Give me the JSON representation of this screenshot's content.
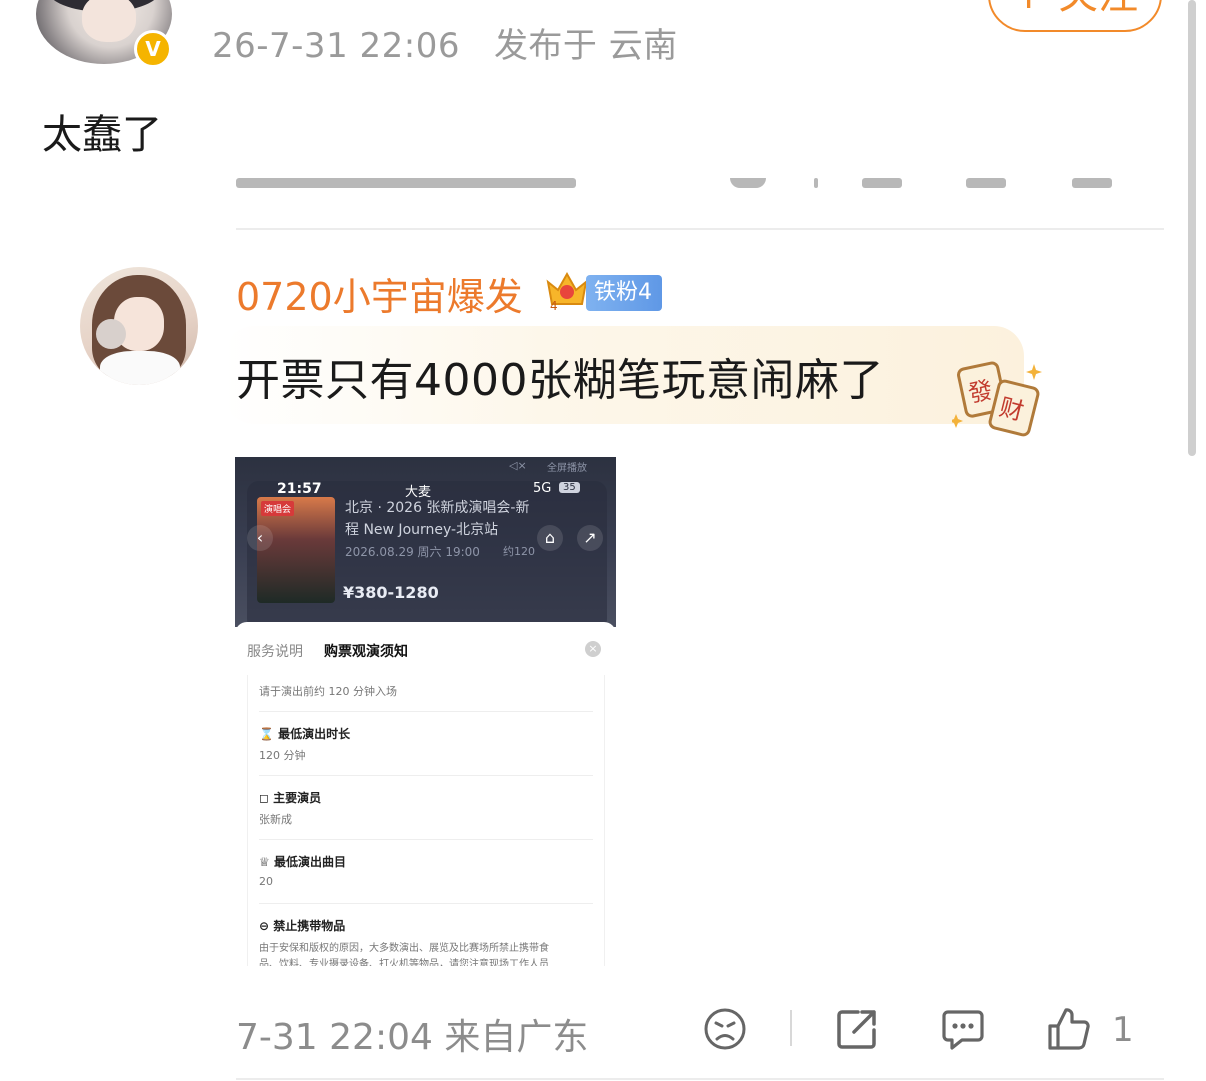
{
  "post": {
    "timestamp": "26-7-31 22:06",
    "location": "发布于 云南",
    "follow_label": "+ 关注",
    "text": "太蠢了",
    "verified_badge": "V"
  },
  "comment": {
    "username": "0720小宇宙爆发",
    "crown_level": "4",
    "fan_badge": "铁粉4",
    "text": "开票只有4000张糊笔玩意闹麻了",
    "sticker_chars": [
      "發",
      "财"
    ],
    "footer": {
      "time_location": "7-31 22:04 来自广东",
      "like_count": "1"
    },
    "attached_image": {
      "status_time": "21:57",
      "app_name": "大麦",
      "network": "5G",
      "battery": "35",
      "sound_label": "全屏播放",
      "poster_tag": "演唱会",
      "title_line1": "北京 · 2026 张新成演唱会-新",
      "title_line2": "程 New Journey-北京站",
      "date_line": "2026.08.29 周六 19:00",
      "venue_hint": "约120",
      "price": "¥380-1280",
      "tab_service": "服务说明",
      "tab_notice": "购票观演须知",
      "entry_note": "请于演出前约 120 分钟入场",
      "items": [
        {
          "title": "最低演出时长",
          "value": "120 分钟"
        },
        {
          "title": "主要演员",
          "value": "张新成"
        },
        {
          "title": "最低演出曲目",
          "value": "20"
        },
        {
          "title": "禁止携带物品",
          "value": "由于安保和版权的原因，大多数演出、展览及比赛场所禁止携带食"
        }
      ],
      "items_tail": "品、饮料、专业摄录设备、打火机等物品，请您注意现场工作人员"
    }
  },
  "colors": {
    "username": "#ec7a2c",
    "follow": "#f28a2a",
    "fan_badge": "#6aa3ea",
    "meta_gray": "#8c8c8c"
  },
  "icons": [
    "crown-icon",
    "mahjong-sticker-icon",
    "dislike-face-icon",
    "share-icon",
    "comment-icon",
    "like-thumb-icon",
    "back-icon",
    "cart-icon",
    "forward-icon"
  ]
}
